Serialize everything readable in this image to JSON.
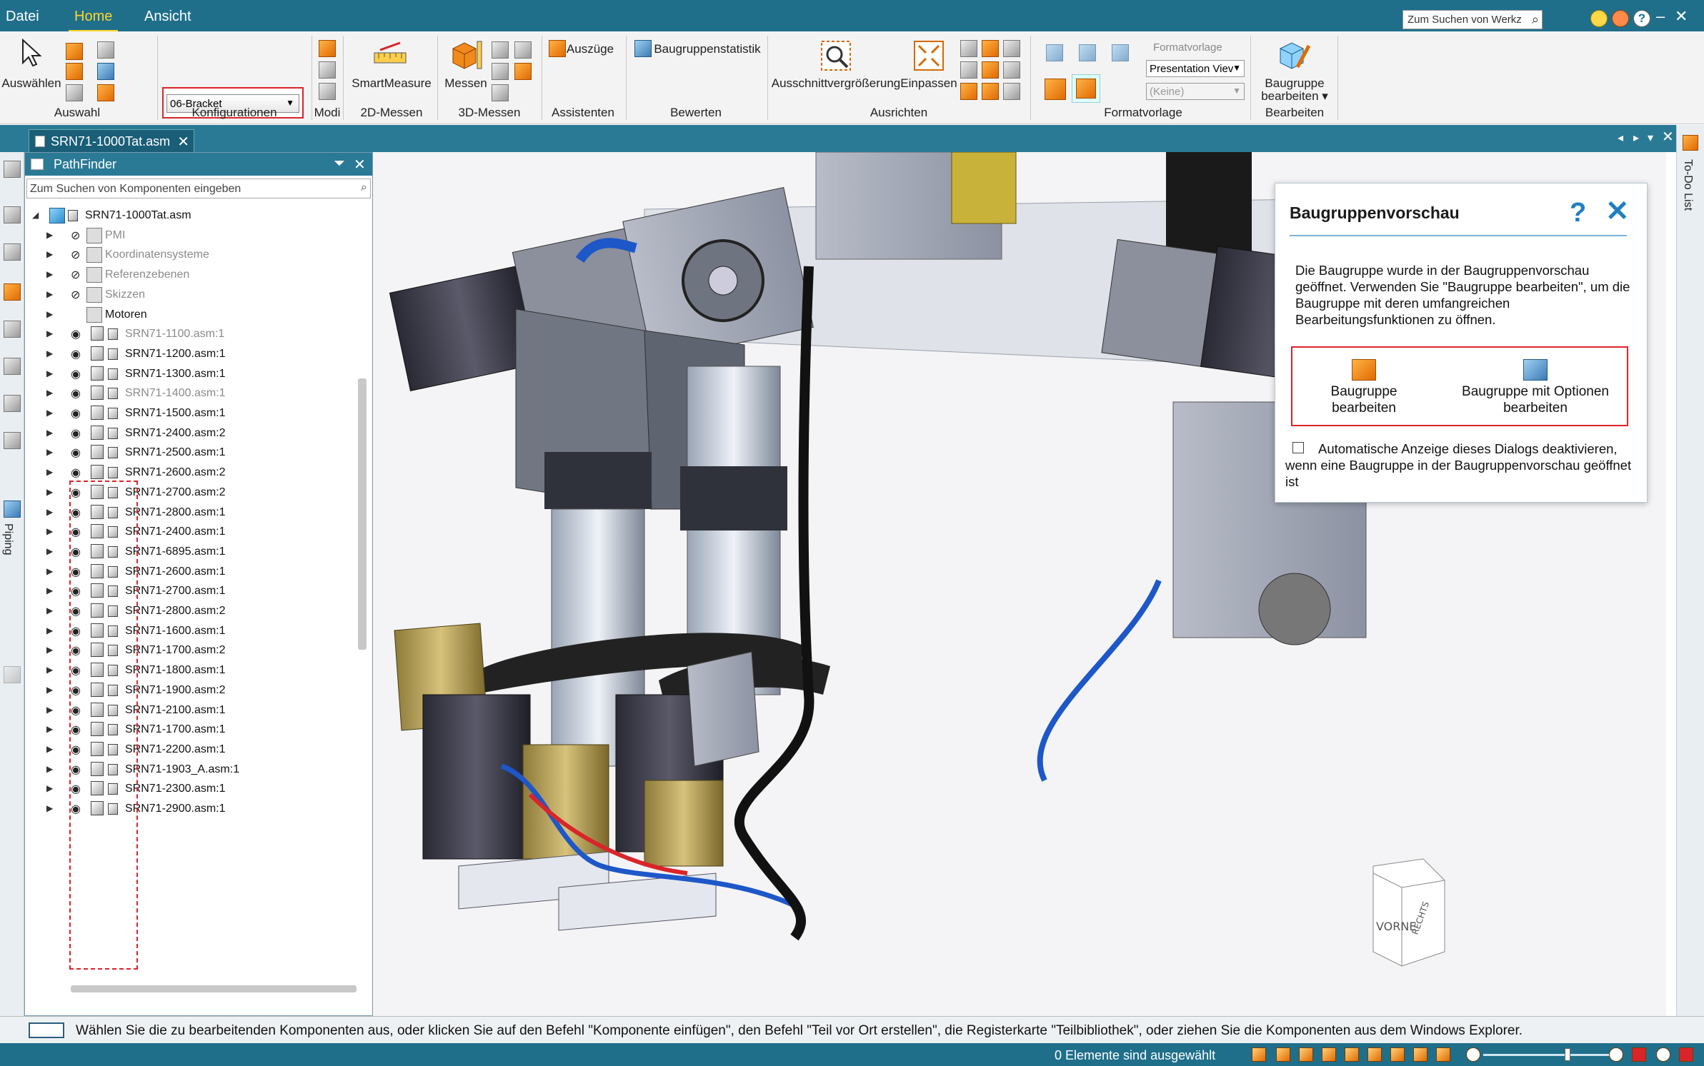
{
  "menu": {
    "file": "Datei",
    "home": "Home",
    "view": "Ansicht"
  },
  "search_placeholder": "Zum Suchen von Werkz",
  "ribbon": {
    "select_label": "Auswählen",
    "groups": {
      "auswahl": "Auswahl",
      "konfig": "Konfigurationen",
      "modi": "Modi",
      "messen2d": "2D-Messen",
      "messen3d": "3D-Messen",
      "assistenten": "Assistenten",
      "bewerten": "Bewerten",
      "ausrichten": "Ausrichten",
      "formatvorlage": "Formatvorlage",
      "bearbeiten": "Bearbeiten"
    },
    "config_value": "06-Bracket",
    "smartmeasure": "SmartMeasure",
    "messen": "Messen",
    "auszuege": "Auszüge",
    "baugruppenstatistik": "Baugruppenstatistik",
    "ausschnitt": "Ausschnittvergrößerung",
    "einpassen": "Einpassen",
    "formatvorlage_label": "Formatvorlage",
    "presentation": "Presentation Viev",
    "keine": "(Keine)",
    "bg_bearbeiten_1": "Baugruppe",
    "bg_bearbeiten_2": "bearbeiten ▾"
  },
  "doc_tab": "SRN71-1000Tat.asm",
  "pathfinder": {
    "title": "PathFinder",
    "search_placeholder": "Zum Suchen von Komponenten eingeben",
    "root": "SRN71-1000Tat.asm",
    "folders": [
      {
        "label": "PMI",
        "dim": true
      },
      {
        "label": "Koordinatensysteme",
        "dim": true
      },
      {
        "label": "Referenzebenen",
        "dim": true
      },
      {
        "label": "Skizzen",
        "dim": true
      },
      {
        "label": "Motoren",
        "dim": false
      }
    ],
    "items": [
      {
        "label": "SRN71-1100.asm:1",
        "dim": true
      },
      {
        "label": "SRN71-1200.asm:1",
        "dim": false
      },
      {
        "label": "SRN71-1300.asm:1",
        "dim": false
      },
      {
        "label": "SRN71-1400.asm:1",
        "dim": true
      },
      {
        "label": "SRN71-1500.asm:1",
        "dim": false
      },
      {
        "label": "SRN71-2400.asm:2",
        "dim": false
      },
      {
        "label": "SRN71-2500.asm:1",
        "dim": false
      },
      {
        "label": "SRN71-2600.asm:2",
        "dim": false
      },
      {
        "label": "SRN71-2700.asm:2",
        "dim": false
      },
      {
        "label": "SRN71-2800.asm:1",
        "dim": false
      },
      {
        "label": "SRN71-2400.asm:1",
        "dim": false
      },
      {
        "label": "SRN71-6895.asm:1",
        "dim": false
      },
      {
        "label": "SRN71-2600.asm:1",
        "dim": false
      },
      {
        "label": "SRN71-2700.asm:1",
        "dim": false
      },
      {
        "label": "SRN71-2800.asm:2",
        "dim": false
      },
      {
        "label": "SRN71-1600.asm:1",
        "dim": false
      },
      {
        "label": "SRN71-1700.asm:2",
        "dim": false
      },
      {
        "label": "SRN71-1800.asm:1",
        "dim": false
      },
      {
        "label": "SRN71-1900.asm:2",
        "dim": false
      },
      {
        "label": "SRN71-2100.asm:1",
        "dim": false
      },
      {
        "label": "SRN71-1700.asm:1",
        "dim": false
      },
      {
        "label": "SRN71-2200.asm:1",
        "dim": false
      },
      {
        "label": "SRN71-1903_A.asm:1",
        "dim": false
      },
      {
        "label": "SRN71-2300.asm:1",
        "dim": false
      },
      {
        "label": "SRN71-2900.asm:1",
        "dim": false
      }
    ]
  },
  "side_left": {
    "piping": "Piping"
  },
  "side_right": {
    "todo": "To-Do List"
  },
  "dialog": {
    "title": "Baugruppenvorschau",
    "help": "?",
    "close": "✕",
    "message": "Die Baugruppe wurde in der Baugruppenvorschau geöffnet. Verwenden Sie \"Baugruppe bearbeiten\", um die Baugruppe mit deren umfangreichen Bearbeitungsfunktionen zu öffnen.",
    "btn1_line1": "Baugruppe",
    "btn1_line2": "bearbeiten",
    "btn2_line1": "Baugruppe mit Optionen",
    "btn2_line2": "bearbeiten",
    "checkbox_label": "Automatische Anzeige dieses Dialogs deaktivieren, wenn eine Baugruppe in der Baugruppenvorschau geöffnet ist"
  },
  "viewcube": {
    "front": "VORNE",
    "right": "RECHTS"
  },
  "prompt": "Wählen Sie die zu bearbeitenden Komponenten aus, oder klicken Sie auf den Befehl \"Komponente einfügen\", den Befehl \"Teil vor Ort erstellen\", die Registerkarte \"Teilbibliothek\", oder ziehen Sie die Komponenten aus dem Windows Explorer.",
  "status": "0 Elemente sind ausgewählt",
  "colors": {
    "accent": "#1f6f8b",
    "highlight": "#d9242a",
    "active_tab": "#ffd42a",
    "dialog_blue": "#1f7fc1"
  },
  "icons": [
    "select-arrow-icon",
    "smartmeasure-icon",
    "measure-icon",
    "zoom-area-icon",
    "fit-icon",
    "edit-assembly-icon",
    "eye-icon",
    "assembly-icon",
    "search-icon",
    "help-icon",
    "close-icon"
  ]
}
